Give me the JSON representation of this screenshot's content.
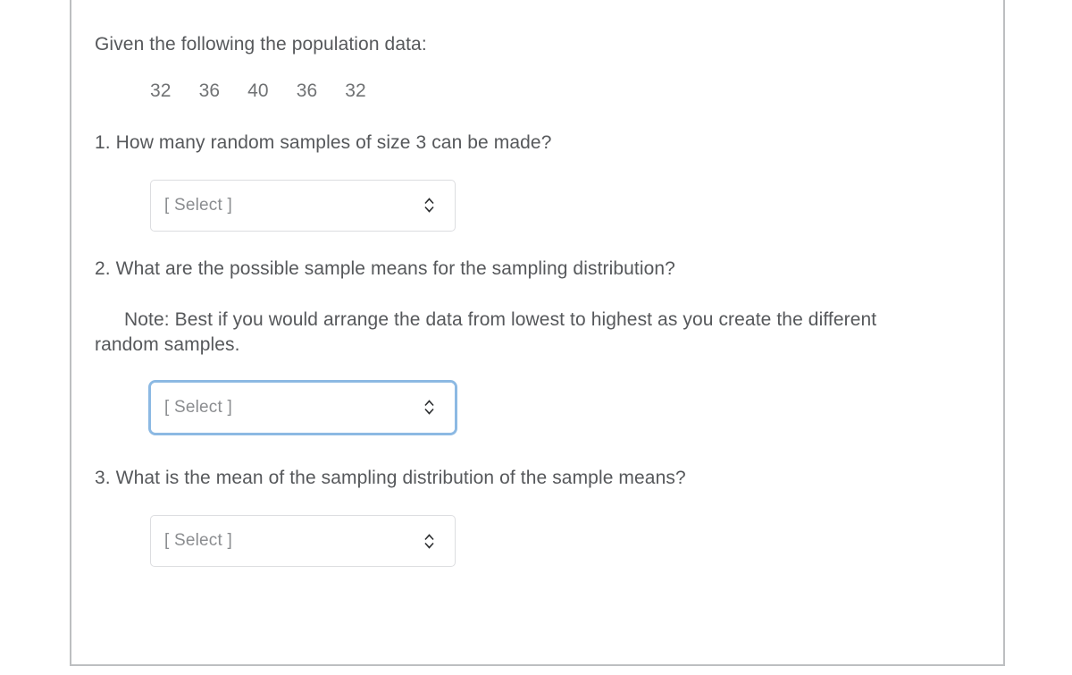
{
  "intro": {
    "text": "Given the following the population data:"
  },
  "population_data": {
    "values": [
      "32",
      "36",
      "40",
      "36",
      "32"
    ]
  },
  "questions": [
    {
      "number": "1",
      "text": "1. How many random samples of size 3 can be made?",
      "select": {
        "value": "[ Select ]",
        "icon": "chevron-updown-icon",
        "focused": false
      }
    },
    {
      "number": "2",
      "text": "2. What are the possible sample means for the sampling distribution?",
      "note": "Note: Best if you would arrange the data from lowest to highest as you create the different random samples.",
      "select": {
        "value": "[ Select ]",
        "icon": "chevron-updown-icon",
        "focused": true
      }
    },
    {
      "number": "3",
      "text": "3. What is the mean of the sampling distribution of the sample means?",
      "select": {
        "value": "[ Select ]",
        "icon": "chevron-updown-icon",
        "focused": false
      }
    }
  ],
  "colors": {
    "text": "#56585b",
    "muted_text": "#707274",
    "placeholder": "#8b8d90",
    "border": "#dcdde0",
    "focus_ring": "#8cb9e3",
    "frame_border": "#bdbfc1",
    "background": "#ffffff"
  }
}
